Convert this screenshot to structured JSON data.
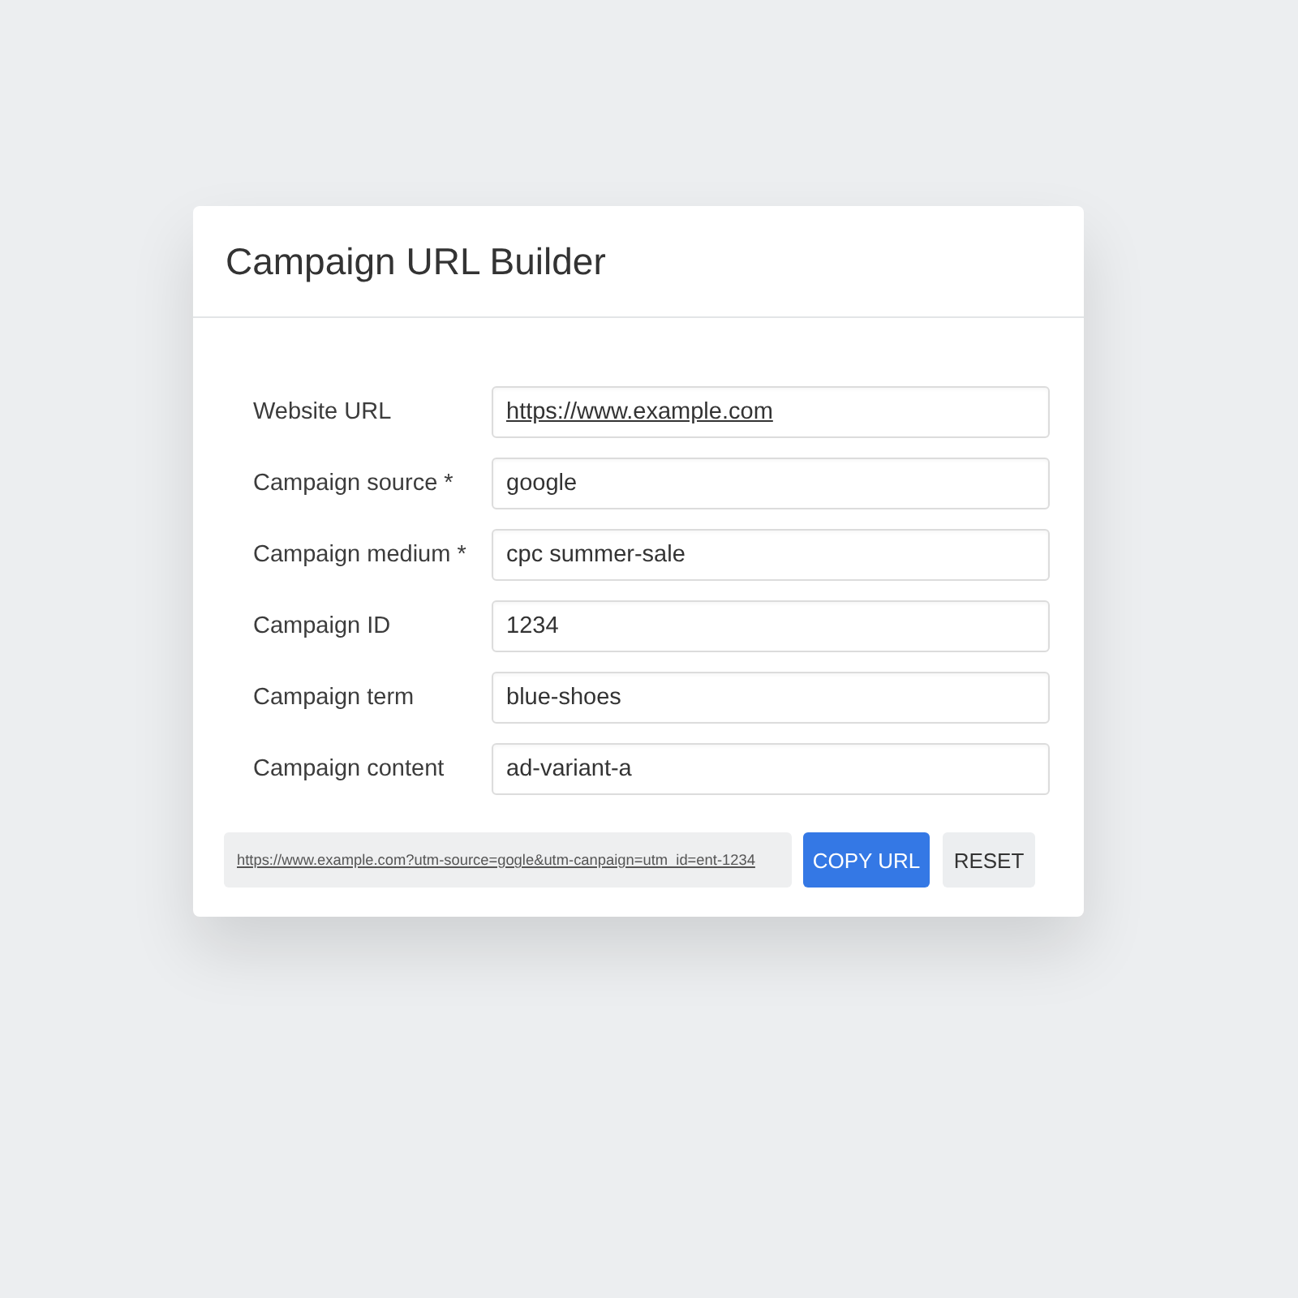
{
  "dialog": {
    "title": "Campaign URL Builder"
  },
  "fields": [
    {
      "label": "Website URL",
      "value": "https://www.example.com",
      "kind": "link"
    },
    {
      "label": "Campaign source *",
      "value": "google",
      "kind": "text"
    },
    {
      "label": "Campaign medium *",
      "value": "cpc summer-sale",
      "kind": "text"
    },
    {
      "label": "Campaign ID",
      "value": "1234",
      "kind": "text"
    },
    {
      "label": "Campaign term",
      "value": "blue-shoes",
      "kind": "text"
    },
    {
      "label": "Campaign content",
      "value": "ad-variant-a",
      "kind": "text"
    }
  ],
  "generated_url": "https://www.example.com?utm-source=gogle&utm-canpaign=utm_id=ent-1234",
  "buttons": [
    {
      "label": "COPY URL",
      "kind": "primary"
    },
    {
      "label": "RESET",
      "kind": "secondary"
    }
  ]
}
